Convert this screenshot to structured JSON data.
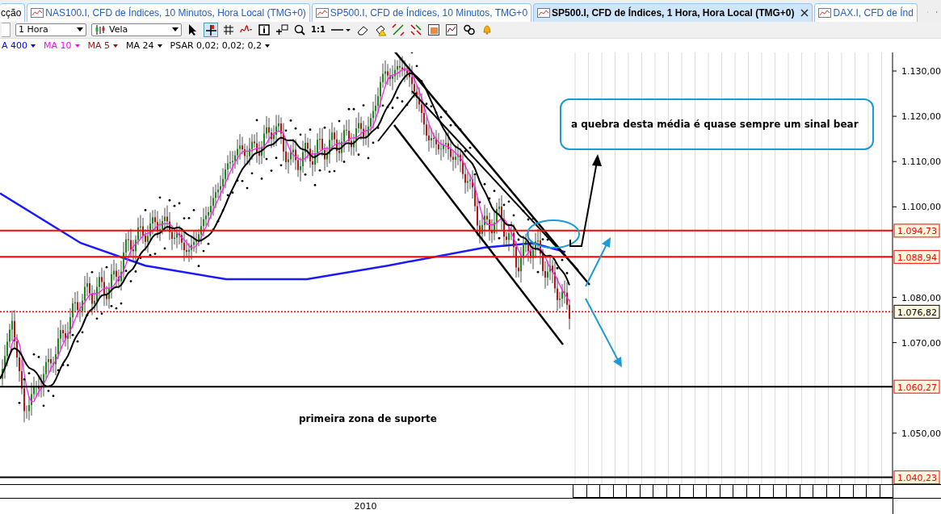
{
  "tabs": [
    {
      "label": "cção",
      "selected": false
    },
    {
      "label": "NAS100.I, CFD de Índices, 10 Minutos, Hora Local (TMG+0)",
      "selected": false
    },
    {
      "label": "SP500.I, CFD de Índices, 10 Minutos, TMG+0",
      "selected": false
    },
    {
      "label": "SP500.I, CFD de Índices, 1 Hora, Hora Local (TMG+0)",
      "selected": true
    },
    {
      "label": "DAX.I, CFD de Índ",
      "selected": false
    }
  ],
  "toolbar": {
    "period": "1 Hora",
    "chart_type": "Vela",
    "zoom_reset": "1:1"
  },
  "indicators": [
    {
      "label": "A 400",
      "color": "#0000ff"
    },
    {
      "label": "MA 10",
      "color": "#ff00ff"
    },
    {
      "label": "MA 5",
      "color": "#8b1a1a"
    },
    {
      "label": "MA 24",
      "color": "#000000"
    },
    {
      "label": "PSAR 0,02; 0,02; 0,2",
      "color": "#000000"
    }
  ],
  "y_axis": {
    "ticks": [
      "1.130,00",
      "1.120,00",
      "1.110,00",
      "1.100,00",
      "1.080,00",
      "1.070,00",
      "1.050,00"
    ]
  },
  "price_levels": [
    {
      "label": "1.094,73",
      "kind": "resistance",
      "color": "#ff0000"
    },
    {
      "label": "1.088,94",
      "kind": "resistance",
      "color": "#ff0000"
    },
    {
      "label": "1.076,82",
      "kind": "last_price",
      "color": "#000000"
    },
    {
      "label": "1.060,27",
      "kind": "support",
      "color": "#ff0000"
    },
    {
      "label": "1.040,23",
      "kind": "support",
      "color": "#ff0000"
    }
  ],
  "annotations": {
    "note": "a quebra desta média é quase sempre um sinal bear",
    "support_label": "primeira zona de suporte"
  },
  "x_axis": {
    "label": "2010"
  }
}
